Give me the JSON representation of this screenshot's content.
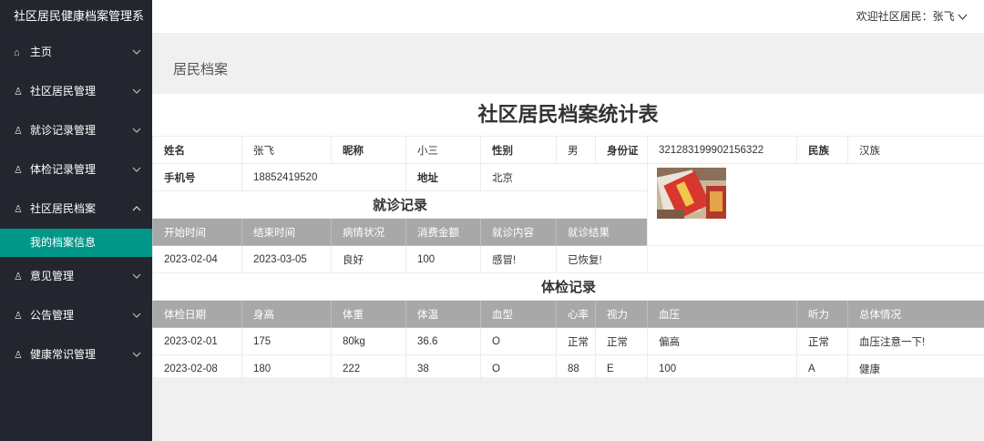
{
  "app": {
    "title": "社区居民健康档案管理系"
  },
  "sidebar": {
    "items": [
      {
        "icon": "home-icon",
        "label": "主页"
      },
      {
        "icon": "user-icon",
        "label": "社区居民管理"
      },
      {
        "icon": "user-icon",
        "label": "就诊记录管理"
      },
      {
        "icon": "user-icon",
        "label": "体检记录管理"
      },
      {
        "icon": "user-icon",
        "label": "社区居民档案",
        "expanded": true
      },
      {
        "icon": "user-icon",
        "label": "意见管理"
      },
      {
        "icon": "user-icon",
        "label": "公告管理"
      },
      {
        "icon": "user-icon",
        "label": "健康常识管理"
      }
    ],
    "submenu": {
      "label": "我的档案信息",
      "active_color": "#009688"
    }
  },
  "header": {
    "welcome": "欢迎社区居民：张飞"
  },
  "page": {
    "breadcrumb": "居民档案",
    "title": "社区居民档案统计表"
  },
  "profile": {
    "name_label": "姓名",
    "name": "张飞",
    "nickname_label": "昵称",
    "nickname": "小三",
    "gender_label": "性别",
    "gender": "男",
    "id_label": "身份证",
    "id_number": "321283199902156322",
    "ethnicity_label": "民族",
    "ethnicity": "汉族",
    "phone_label": "手机号",
    "phone": "18852419520",
    "address_label": "地址",
    "address": "北京"
  },
  "visits": {
    "title": "就诊记录",
    "headers": [
      "开始时间",
      "结束时间",
      "病情状况",
      "消费金额",
      "就诊内容",
      "就诊结果"
    ],
    "rows": [
      [
        "2023-02-04",
        "2023-03-05",
        "良好",
        "100",
        "感冒!",
        "已恢复!"
      ]
    ]
  },
  "checkups": {
    "title": "体检记录",
    "headers": [
      "体检日期",
      "身高",
      "体重",
      "体温",
      "血型",
      "心率",
      "视力",
      "血压",
      "听力",
      "总体情况"
    ],
    "rows": [
      [
        "2023-02-01",
        "175",
        "80kg",
        "36.6",
        "O",
        "正常",
        "正常",
        "偏高",
        "正常",
        "血压注意一下!"
      ],
      [
        "2023-02-08",
        "180",
        "222",
        "38",
        "O",
        "88",
        "E",
        "100",
        "A",
        "健康"
      ]
    ]
  },
  "colors": {
    "sidebar_bg": "#23262e",
    "accent": "#009688",
    "table_header_bg": "#a8a8a8"
  }
}
